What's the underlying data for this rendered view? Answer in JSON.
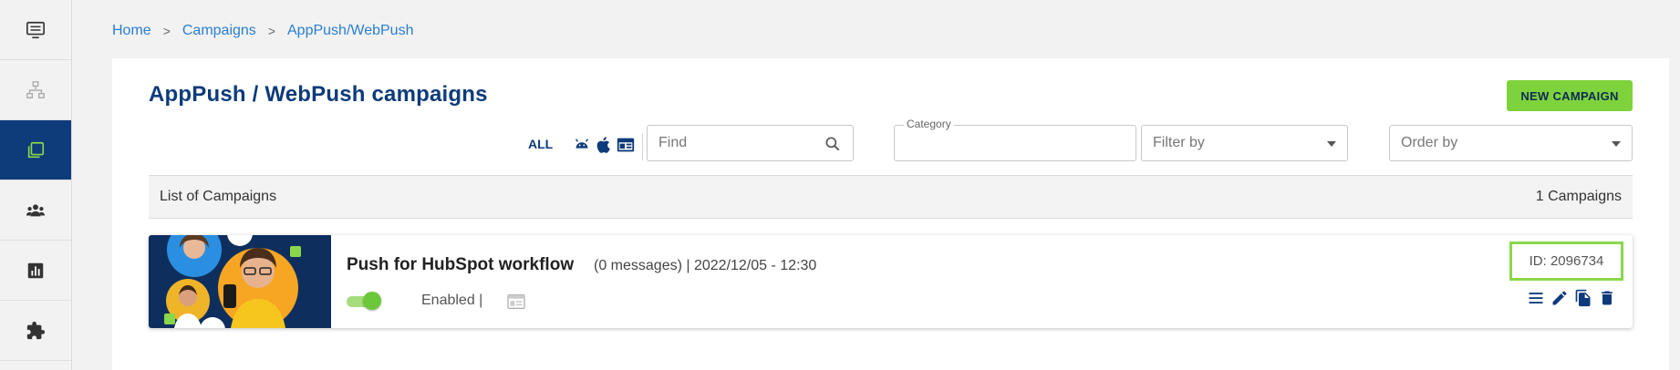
{
  "sidebar": {
    "items": [
      {
        "icon": "monitor-icon",
        "active": false
      },
      {
        "icon": "sitemap-icon",
        "active": false
      },
      {
        "icon": "campaigns-icon",
        "active": true
      },
      {
        "icon": "users-icon",
        "active": false
      },
      {
        "icon": "chart-icon",
        "active": false
      },
      {
        "icon": "puzzle-icon",
        "active": false
      }
    ]
  },
  "breadcrumb": {
    "home": "Home",
    "sep1": ">",
    "campaigns": "Campaigns",
    "sep2": ">",
    "current": "AppPush/WebPush"
  },
  "page": {
    "title": "AppPush / WebPush campaigns",
    "new_campaign_label": "NEW CAMPAIGN"
  },
  "filters": {
    "all_label": "ALL",
    "platform_icons": [
      "android-icon",
      "apple-icon",
      "web-icon"
    ],
    "find_placeholder": "Find",
    "category_label": "Category",
    "category_value": "",
    "filter_by_placeholder": "Filter by",
    "order_by_placeholder": "Order by"
  },
  "list": {
    "title": "List of Campaigns",
    "count": "1 Campaigns",
    "rows": [
      {
        "name": "Push for HubSpot workflow",
        "meta": "(0 messages) | 2022/12/05 - 12:30",
        "enabled": true,
        "status": "Enabled |",
        "id_label": "ID: 2096734"
      }
    ]
  },
  "colors": {
    "brand": "#0e3b7a",
    "link": "#2a7fd0",
    "accent_green": "#7ed33c",
    "highlight_green": "#8ad84a"
  }
}
